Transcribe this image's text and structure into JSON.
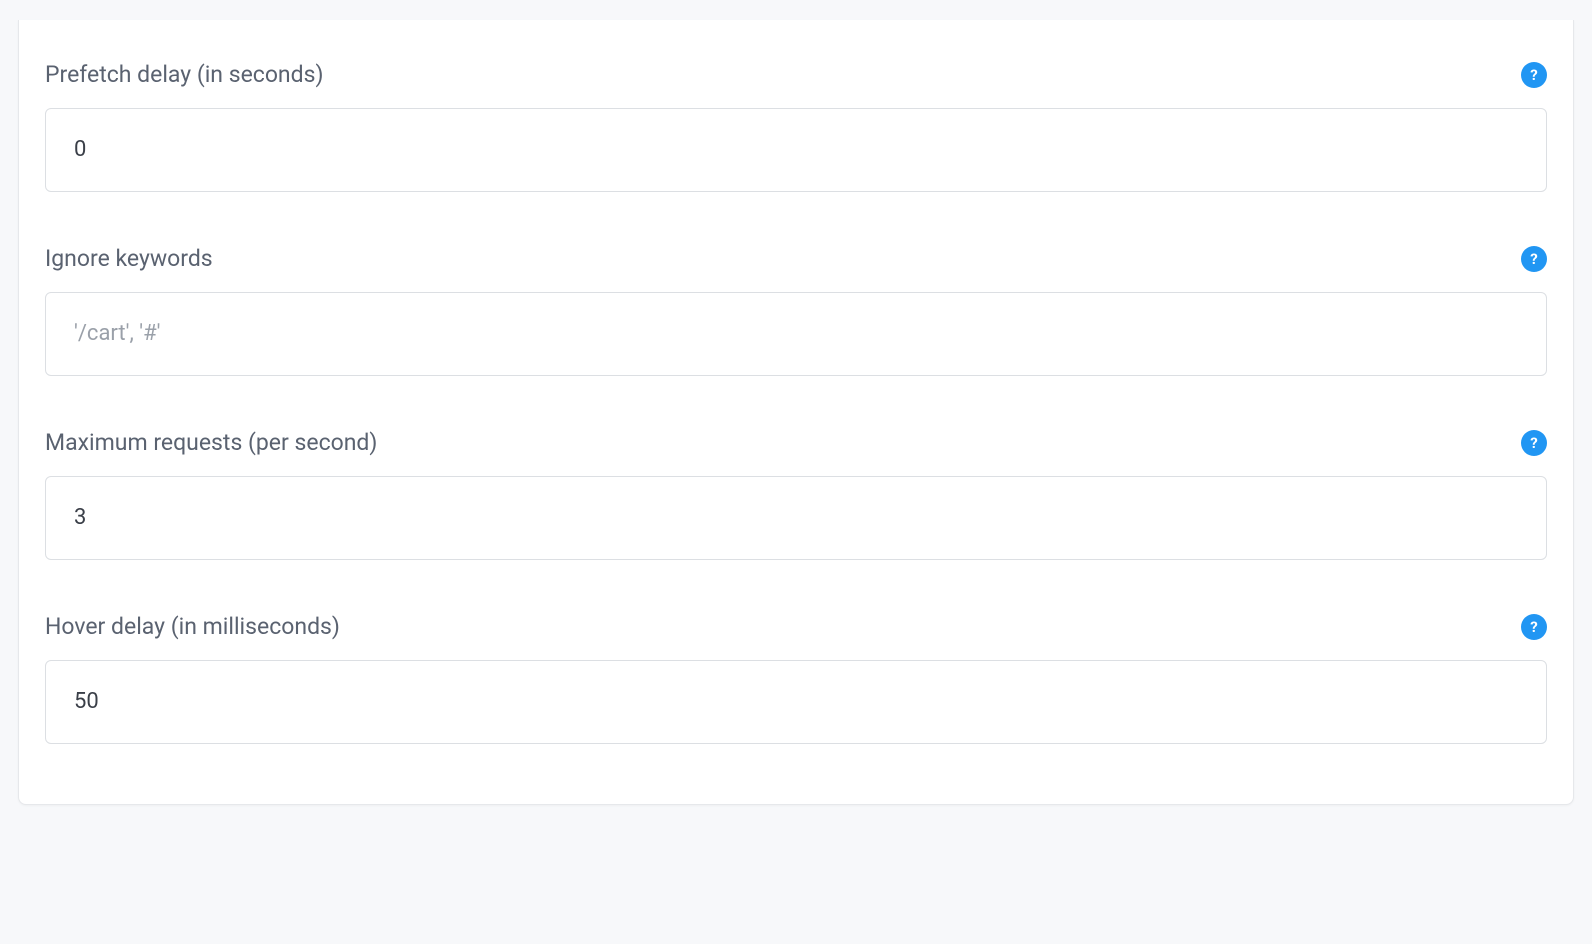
{
  "fields": {
    "prefetch_delay": {
      "label": "Prefetch delay (in seconds)",
      "value": "0",
      "placeholder": ""
    },
    "ignore_keywords": {
      "label": "Ignore keywords",
      "value": "",
      "placeholder": "'/cart', '#'"
    },
    "max_requests": {
      "label": "Maximum requests (per second)",
      "value": "3",
      "placeholder": ""
    },
    "hover_delay": {
      "label": "Hover delay (in milliseconds)",
      "value": "50",
      "placeholder": ""
    }
  },
  "help_glyph": "?"
}
